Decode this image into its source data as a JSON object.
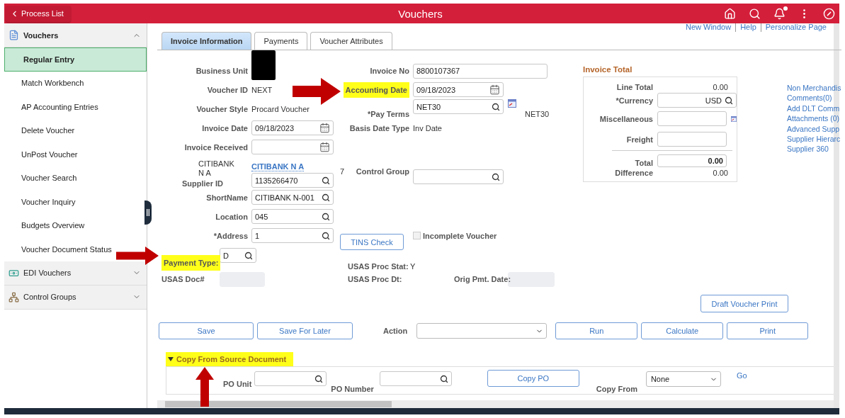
{
  "header": {
    "back_button": "Process List",
    "title": "Vouchers",
    "notification_unread": true
  },
  "sidebar": {
    "groups": [
      {
        "label": "Vouchers",
        "expanded": true,
        "items": [
          {
            "label": "Regular Entry",
            "selected": true
          },
          {
            "label": "Match Workbench",
            "selected": false
          },
          {
            "label": "AP Accounting Entries",
            "selected": false
          },
          {
            "label": "Delete Voucher",
            "selected": false
          },
          {
            "label": "UnPost Voucher",
            "selected": false
          },
          {
            "label": "Voucher Search",
            "selected": false
          },
          {
            "label": "Voucher Inquiry",
            "selected": false
          },
          {
            "label": "Budgets Overview",
            "selected": false
          },
          {
            "label": "Voucher Document Status",
            "selected": false
          }
        ]
      },
      {
        "label": "EDI Vouchers",
        "expanded": false
      },
      {
        "label": "Control Groups",
        "expanded": false
      }
    ]
  },
  "page_links": [
    "New Window",
    "Help",
    "Personalize Page"
  ],
  "tabs": [
    {
      "label": "Invoice Information",
      "selected": true
    },
    {
      "label": "Payments",
      "selected": false
    },
    {
      "label": "Voucher Attributes",
      "selected": false
    }
  ],
  "invoice_form": {
    "business_unit": {
      "label": "Business Unit",
      "redacted": true
    },
    "invoice_no": {
      "label": "Invoice No",
      "value": "8800107367"
    },
    "voucher_id": {
      "label": "Voucher ID",
      "value": "NEXT"
    },
    "accounting_date": {
      "label": "Accounting Date",
      "value": "09/18/2023",
      "highlighted": true,
      "arrow": true
    },
    "voucher_style": {
      "label": "Voucher Style",
      "value": "Procard Voucher"
    },
    "pay_terms": {
      "label": "*Pay Terms",
      "value": "NET30",
      "description": "NET30"
    },
    "invoice_date": {
      "label": "Invoice Date",
      "value": "09/18/2023"
    },
    "basis_date_type": {
      "label": "Basis Date Type",
      "value": "Inv Date"
    },
    "invoice_received": {
      "label": "Invoice Received"
    },
    "supplier_name": "CITIBANK N A",
    "supplier_link": "CITIBANK N A",
    "supplier_id": {
      "label": "Supplier ID",
      "value": "1135266470"
    },
    "supplier_suffix": "7",
    "control_group": {
      "label": "Control Group"
    },
    "short_name": {
      "label": "ShortName",
      "value": "CITIBANK N-001"
    },
    "location": {
      "label": "Location",
      "value": "045"
    },
    "address": {
      "label": "*Address",
      "value": "1"
    },
    "tins_button": "TINS Check",
    "incomplete_voucher": {
      "label": "Incomplete Voucher",
      "checked": false,
      "disabled": true
    },
    "payment_type": {
      "label": "Payment Type:",
      "value": "D",
      "highlighted": true,
      "arrow": true
    },
    "usas_proc_stat": {
      "label": "USAS Proc Stat:",
      "value": "Y"
    },
    "usas_doc": {
      "label": "USAS Doc#",
      "disabled": true
    },
    "usas_proc_dt": {
      "label": "USAS Proc Dt:"
    },
    "orig_pmt_date": {
      "label": "Orig Pmt. Date:",
      "disabled": true
    }
  },
  "invoice_total": {
    "title": "Invoice Total",
    "line_total": {
      "label": "Line Total",
      "value": "0.00"
    },
    "currency": {
      "label": "*Currency",
      "value": "USD"
    },
    "miscellaneous": {
      "label": "Miscellaneous"
    },
    "freight": {
      "label": "Freight"
    },
    "total": {
      "label": "Total",
      "value": "0.00"
    },
    "difference": {
      "label": "Difference",
      "value": "0.00"
    }
  },
  "related_links": [
    "Non Merchandis",
    "Comments(0)",
    "Add DLT Comm",
    "Attachments (0)",
    "Advanced Supp",
    "Supplier Hierarc",
    "Supplier 360"
  ],
  "actions": {
    "draft_print": "Draft Voucher Print",
    "save": "Save",
    "save_later": "Save For Later",
    "action_label": "Action",
    "run": "Run",
    "calculate": "Calculate",
    "print": "Print"
  },
  "copy_section": {
    "title": "Copy From Source Document",
    "expanded": true,
    "highlighted": true,
    "arrow": true,
    "po_unit_label": "PO Unit",
    "po_number_label": "PO Number",
    "copy_po": "Copy PO",
    "copy_from_label": "Copy From",
    "copy_from_value": "None",
    "go": "Go"
  }
}
